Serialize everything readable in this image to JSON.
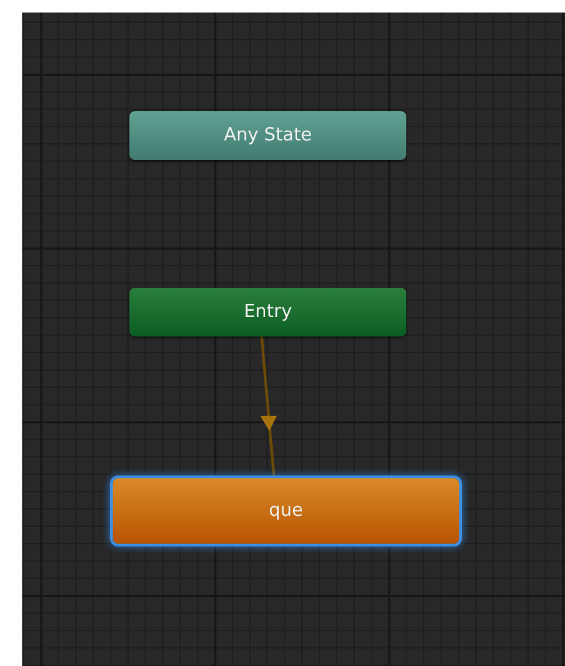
{
  "graph": {
    "nodes": [
      {
        "label": "Any State",
        "kind": "any_state",
        "selected": false
      },
      {
        "label": "Entry",
        "kind": "entry",
        "selected": false
      },
      {
        "label": "que",
        "kind": "state",
        "selected": true
      }
    ]
  }
}
